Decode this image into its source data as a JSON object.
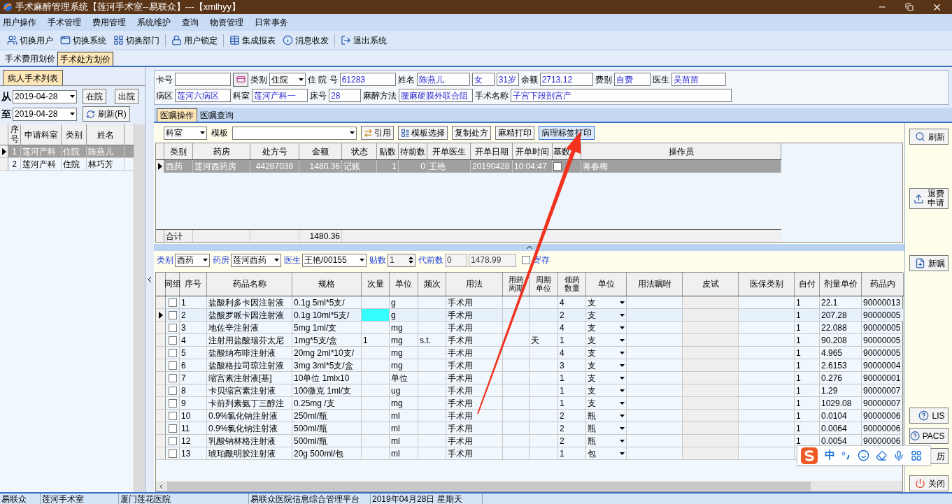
{
  "window": {
    "title": "手术麻醉管理系统【莲河手术室--易联众】---【xmlhyy】"
  },
  "menu": [
    "用户操作",
    "手术管理",
    "费用管理",
    "系统维护",
    "查询",
    "物资管理",
    "日常事务"
  ],
  "toolbar": [
    "切换用户",
    "切换系统",
    "切换部门",
    "用户锁定",
    "集成报表",
    "消息收发",
    "退出系统"
  ],
  "page_tabs": [
    {
      "label": "手术费用划价",
      "selected": false
    },
    {
      "label": "手术处方划价",
      "selected": true
    }
  ],
  "left_panel": {
    "tab": {
      "label": "病人手术列表",
      "selected": true
    },
    "from_label": "从",
    "from_date": "2019-04-28",
    "to_label": "至",
    "to_date": "2019-04-28",
    "in_button": "在院",
    "out_button": "出院",
    "refresh_button": "刷新(R)",
    "columns": [
      "序号",
      "申请科室",
      "类别",
      "姓名"
    ],
    "rows": [
      {
        "selected": true,
        "cells": [
          "1",
          "莲河产科",
          "住院",
          "陈燕儿"
        ]
      },
      {
        "selected": false,
        "cells": [
          "2",
          "莲河产科",
          "住院",
          "林巧芳"
        ]
      }
    ]
  },
  "patient": {
    "rows": [
      [
        {
          "label": "卡号",
          "kind": "card"
        },
        {
          "label": "类别",
          "value": "住院",
          "kind": "select"
        },
        {
          "label": "住 院 号",
          "value": "61283",
          "kind": "input"
        },
        {
          "label": "姓名",
          "value": "陈燕儿",
          "kind": "input"
        },
        {
          "value": "女",
          "kind": "input"
        },
        {
          "value": "31岁",
          "kind": "input"
        },
        {
          "label": "余额",
          "value": "2713.12",
          "kind": "input"
        },
        {
          "label": "费别",
          "value": "自费",
          "kind": "input"
        },
        {
          "label": "医生",
          "value": "吴苗苗",
          "kind": "input"
        }
      ],
      [
        {
          "label": "病区",
          "value": "莲河六病区",
          "kind": "input"
        },
        {
          "label": "科室",
          "value": "莲河产科一",
          "kind": "input"
        },
        {
          "label": "床号",
          "value": "28",
          "kind": "input"
        },
        {
          "label": "麻醉方法",
          "value": "腰麻硬膜外联合阻",
          "kind": "input"
        },
        {
          "label": "手术名称",
          "value": "子宫下段剖宫产",
          "kind": "input"
        }
      ]
    ]
  },
  "sub_tabs": [
    {
      "label": "医嘱操作",
      "selected": true
    },
    {
      "label": "医嘱查询",
      "selected": false
    }
  ],
  "order_toolbar": {
    "dept_select": "科室",
    "template_label": "模板",
    "buttons": [
      {
        "label": "引用",
        "focused": false
      },
      {
        "label": "模板选择",
        "focused": false
      },
      {
        "label": "复制处方",
        "focused": false
      },
      {
        "label": "麻精打印",
        "focused": false
      },
      {
        "label": "病理标签打印",
        "focused": true
      }
    ]
  },
  "prescriptions": {
    "columns": [
      {
        "label": "类别"
      },
      {
        "label": "药房"
      },
      {
        "label": "处方号"
      },
      {
        "label": "金额"
      },
      {
        "label": "状态"
      },
      {
        "label": "贴数"
      },
      {
        "label": "待前数"
      },
      {
        "label": "开单医生"
      },
      {
        "label": "开单日期"
      },
      {
        "label": "开单时间"
      },
      {
        "label": "基数",
        "kind": "checkbox"
      },
      {
        "label": "操作员"
      }
    ],
    "rows": [
      {
        "selected": true,
        "cells": [
          "西药",
          "莲河西药房",
          "44287038",
          "1480.36",
          "记账",
          "1",
          "0",
          "王艳",
          "20190428",
          "10:04:47",
          false,
          "蒋春梅"
        ]
      }
    ],
    "totals": {
      "label": "合计",
      "amount": "1480.36"
    }
  },
  "filter": [
    {
      "kind": "select",
      "label": "类别",
      "value": "西药"
    },
    {
      "kind": "select",
      "label": "药房",
      "value": "莲河西药"
    },
    {
      "kind": "select",
      "label": "医生",
      "value": "王艳/00155"
    },
    {
      "kind": "spinner",
      "label": "贴数",
      "value": "1"
    },
    {
      "kind": "input",
      "label": "代前数",
      "value": "0"
    },
    {
      "kind": "input",
      "value": "1478.99"
    },
    {
      "kind": "checkbox",
      "label": "寄存",
      "checked": false
    }
  ],
  "drugs": {
    "columns": [
      {
        "label": "同组",
        "kind": "checkbox"
      },
      {
        "label": "序号"
      },
      {
        "label": "药品名称"
      },
      {
        "label": "规格"
      },
      {
        "label": "次量"
      },
      {
        "label": "单位"
      },
      {
        "label": "频次"
      },
      {
        "label": "用法"
      },
      {
        "label": "用药周期"
      },
      {
        "label": "周期单位"
      },
      {
        "label": "领药数量"
      },
      {
        "label": "单位",
        "kind": "select"
      },
      {
        "label": "用法嘱咐"
      },
      {
        "label": "皮试"
      },
      {
        "label": "医保类别"
      },
      {
        "label": "自付"
      },
      {
        "label": "剂量单价"
      },
      {
        "label": "药品内"
      }
    ],
    "rows": [
      {
        "selected": false,
        "cells": [
          false,
          "1",
          "盐酸利多卡因注射液",
          "0.1g 5ml*5支/",
          null,
          "g",
          null,
          "手术用",
          null,
          null,
          "4",
          "支",
          null,
          null,
          null,
          "1",
          "22.1",
          "90000013"
        ]
      },
      {
        "selected": true,
        "cells": [
          false,
          "2",
          "盐酸罗哌卡因注射液",
          "0.1g 10ml*5支/",
          {
            "editing": true
          },
          "g",
          null,
          "手术用",
          null,
          null,
          "2",
          "支",
          null,
          null,
          null,
          "1",
          "207.28",
          "90000005"
        ]
      },
      {
        "selected": false,
        "cells": [
          false,
          "3",
          "地佐辛注射液",
          "5mg 1ml/支",
          null,
          "mg",
          null,
          "手术用",
          null,
          null,
          "4",
          "支",
          null,
          null,
          null,
          "1",
          "22.088",
          "90000005"
        ]
      },
      {
        "selected": false,
        "cells": [
          false,
          "4",
          "注射用盐酸瑞芬太尼",
          "1mg*5支/盒",
          "1",
          "mg",
          "s.t.",
          "手术用",
          null,
          "天",
          "1",
          "支",
          null,
          null,
          null,
          "1",
          "90.208",
          "90000005"
        ]
      },
      {
        "selected": false,
        "cells": [
          false,
          "5",
          "盐酸纳布啡注射液",
          "20mg 2ml*10支/",
          null,
          "mg",
          null,
          "手术用",
          null,
          null,
          "4",
          "支",
          null,
          null,
          null,
          "1",
          "4.965",
          "90000005"
        ]
      },
      {
        "selected": false,
        "cells": [
          false,
          "6",
          "盐酸格拉司琼注射液",
          "3mg 3ml*5支/盒",
          null,
          "mg",
          null,
          "手术用",
          null,
          null,
          "3",
          "支",
          null,
          null,
          null,
          "1",
          "2.6153",
          "90000004"
        ]
      },
      {
        "selected": false,
        "cells": [
          false,
          "7",
          "缩宫素注射液[基]",
          "10单位 1mlx10",
          null,
          "单位",
          null,
          "手术用",
          null,
          null,
          "1",
          "支",
          null,
          null,
          null,
          "1",
          "0.276",
          "90000001"
        ]
      },
      {
        "selected": false,
        "cells": [
          false,
          "8",
          "卡贝缩宫素注射液",
          "100微克 1ml/支",
          null,
          "ug",
          null,
          "手术用",
          null,
          null,
          "1",
          "支",
          null,
          null,
          null,
          "1",
          "1.29",
          "90000007"
        ]
      },
      {
        "selected": false,
        "cells": [
          false,
          "9",
          "卡前列素氨丁三醇注",
          "0.25mg /支",
          null,
          "mg",
          null,
          "手术用",
          null,
          null,
          "1",
          "支",
          null,
          null,
          null,
          "1",
          "1029.08",
          "90000007"
        ]
      },
      {
        "selected": false,
        "cells": [
          false,
          "10",
          "0.9%氯化钠注射液",
          "250ml/瓶",
          null,
          "ml",
          null,
          "手术用",
          null,
          null,
          "2",
          "瓶",
          null,
          null,
          null,
          "1",
          "0.0104",
          "90000006"
        ]
      },
      {
        "selected": false,
        "cells": [
          false,
          "11",
          "0.9%氯化钠注射液",
          "500ml/瓶",
          null,
          "ml",
          null,
          "手术用",
          null,
          null,
          "2",
          "瓶",
          null,
          null,
          null,
          "1",
          "0.0064",
          "90000006"
        ]
      },
      {
        "selected": false,
        "cells": [
          false,
          "12",
          "乳酸钠林格注射液",
          "500ml/瓶",
          null,
          "ml",
          null,
          "手术用",
          null,
          null,
          "2",
          "瓶",
          null,
          null,
          null,
          "1",
          "0.0054",
          "90000006"
        ]
      },
      {
        "selected": false,
        "cells": [
          false,
          "13",
          "琥珀酰明胶注射液",
          "20g 500ml/包",
          null,
          "ml",
          null,
          "手术用",
          null,
          null,
          "1",
          "包",
          null,
          null,
          null,
          null,
          null,
          null
        ]
      }
    ]
  },
  "side_buttons": [
    "刷新",
    "退费申请",
    "新嘱",
    "LIS",
    "PACS",
    "历",
    "关闭"
  ],
  "ime": {
    "mode": "中"
  },
  "status_bar": [
    "易联众",
    "莲河手术室",
    "厦门莲花医院",
    "易联众医院信息综合管理平台",
    "2019年04月28日 星期天"
  ]
}
